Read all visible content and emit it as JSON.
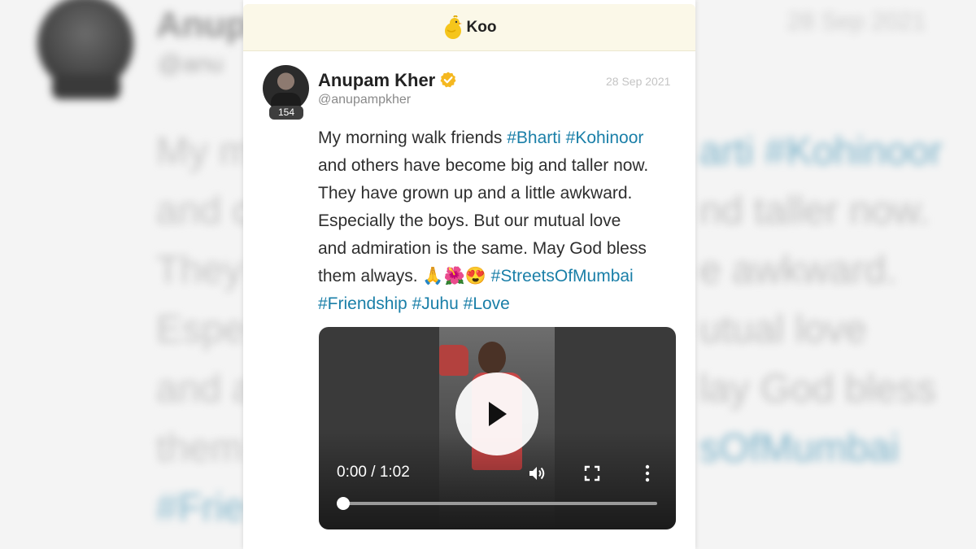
{
  "app": {
    "name": "Koo",
    "brand_color": "#fbf8e8",
    "accent": "#f5c51b"
  },
  "author": {
    "name": "Anupam Kher",
    "handle": "@anupampkher",
    "follower_badge": "154",
    "verified": true
  },
  "post": {
    "date": "28 Sep 2021",
    "lines": [
      [
        {
          "t": "My morning walk friends ",
          "tag": false
        },
        {
          "t": "#Bharti",
          "tag": true
        },
        {
          "t": " ",
          "tag": false
        },
        {
          "t": "#Kohinoor",
          "tag": true
        }
      ],
      [
        {
          "t": "and others have become big and taller now.",
          "tag": false
        }
      ],
      [
        {
          "t": "They have grown up and a little awkward.",
          "tag": false
        }
      ],
      [
        {
          "t": "Especially the boys. But our mutual love",
          "tag": false
        }
      ],
      [
        {
          "t": "and admiration is the same. May God bless",
          "tag": false
        }
      ],
      [
        {
          "t": "them always. 🙏🌺😍 ",
          "tag": false
        },
        {
          "t": "#StreetsOfMumbai",
          "tag": true
        }
      ],
      [
        {
          "t": "#Friendship",
          "tag": true
        },
        {
          "t": " ",
          "tag": false
        },
        {
          "t": "#Juhu",
          "tag": true
        },
        {
          "t": " ",
          "tag": false
        },
        {
          "t": "#Love",
          "tag": true
        }
      ]
    ],
    "hashtag_color": "#1a7fa8"
  },
  "video": {
    "time_display": "0:00 / 1:02",
    "progress": 0.0
  },
  "background": {
    "name": "Anup",
    "handle": "@anu",
    "date": "28 Sep 2021",
    "lines": [
      [
        {
          "t": "My m",
          "tag": false
        }
      ],
      [
        {
          "t": "and c",
          "tag": false
        }
      ],
      [
        {
          "t": "They",
          "tag": false
        }
      ],
      [
        {
          "t": "Espe",
          "tag": false
        }
      ],
      [
        {
          "t": "and a",
          "tag": false
        }
      ],
      [
        {
          "t": "them",
          "tag": false
        }
      ],
      [
        {
          "t": "#Frie",
          "tag": true
        }
      ]
    ],
    "right_lines": [
      [
        {
          "t": "arti ",
          "tag": true
        },
        {
          "t": "#Kohinoor",
          "tag": true
        }
      ],
      [
        {
          "t": "nd taller now.",
          "tag": false
        }
      ],
      [
        {
          "t": "e awkward.",
          "tag": false
        }
      ],
      [
        {
          "t": "utual love",
          "tag": false
        }
      ],
      [
        {
          "t": "lay God bless",
          "tag": false
        }
      ],
      [
        {
          "t": "sOfMumbai",
          "tag": true
        }
      ],
      [
        {
          "t": "",
          "tag": false
        }
      ]
    ]
  }
}
